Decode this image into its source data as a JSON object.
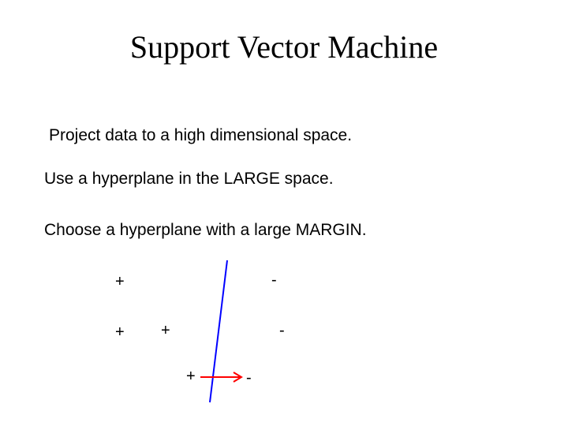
{
  "title": "Support Vector Machine",
  "bullets": {
    "b1": "Project data to a high dimensional space.",
    "b2": "Use a hyperplane in the LARGE space.",
    "b3": "Choose a hyperplane with a large MARGIN."
  },
  "diagram": {
    "plus": [
      "+",
      "+",
      "+",
      "+"
    ],
    "minus": [
      "-",
      "-",
      "-"
    ],
    "colors": {
      "line": "#0000ff",
      "arrow": "#ff0000"
    }
  }
}
